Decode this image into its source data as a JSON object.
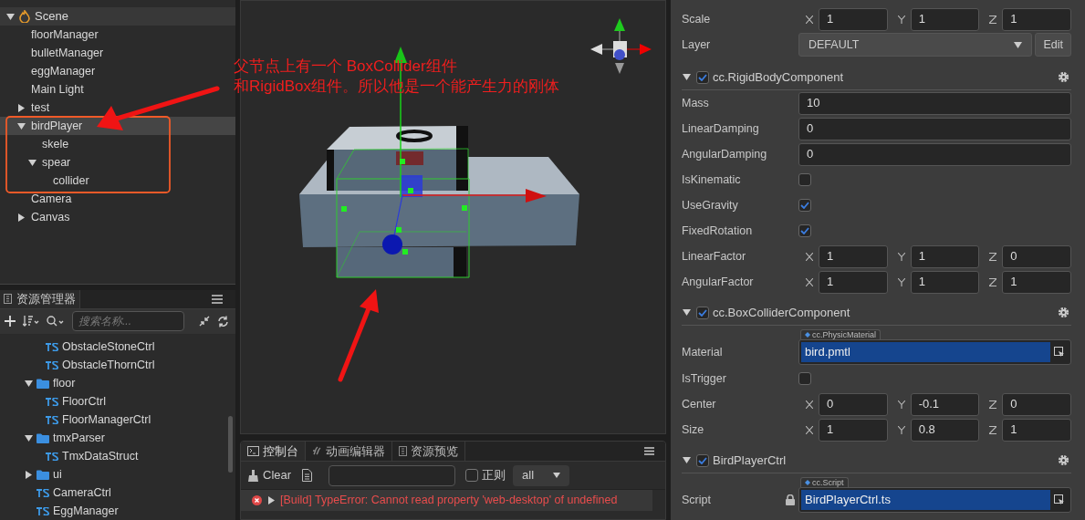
{
  "hierarchy": {
    "root": {
      "label": "Scene",
      "expanded": true,
      "selected": false,
      "children": [
        {
          "label": "floorManager",
          "selected": false
        },
        {
          "label": "bulletManager",
          "selected": false
        },
        {
          "label": "eggManager",
          "selected": false
        },
        {
          "label": "Main Light",
          "selected": false
        },
        {
          "label": "test",
          "expanded": false,
          "selected": false
        },
        {
          "label": "birdPlayer",
          "expanded": true,
          "selected": true,
          "children": [
            {
              "label": "skele",
              "selected": false
            },
            {
              "label": "spear",
              "expanded": true,
              "selected": false,
              "children": [
                {
                  "label": "collider",
                  "selected": false
                }
              ]
            }
          ]
        },
        {
          "label": "Camera",
          "selected": false
        },
        {
          "label": "Canvas",
          "expanded": false,
          "selected": false
        }
      ]
    }
  },
  "assets": {
    "title": "资源管理器",
    "search": {
      "placeholder": "搜索名称..."
    },
    "items": [
      {
        "children": [
          {
            "kind": "script",
            "label": "ObstacleStoneCtrl"
          },
          {
            "kind": "script",
            "label": "ObstacleThornCtrl"
          }
        ]
      },
      {
        "kind": "folder",
        "label": "floor",
        "expanded": true,
        "children": [
          {
            "kind": "script",
            "label": "FloorCtrl"
          },
          {
            "kind": "script",
            "label": "FloorManagerCtrl"
          }
        ]
      },
      {
        "kind": "folder",
        "label": "tmxParser",
        "expanded": true,
        "children": [
          {
            "kind": "script",
            "label": "TmxDataStruct"
          }
        ]
      },
      {
        "kind": "folder",
        "label": "ui",
        "expanded": false
      },
      {
        "kind": "script",
        "label": "CameraCtrl"
      },
      {
        "kind": "script",
        "label": "EggManager"
      }
    ]
  },
  "console": {
    "tabs": [
      {
        "label": "控制台",
        "selected": true
      },
      {
        "label": "动画编辑器",
        "selected": false
      },
      {
        "label": "资源预览",
        "selected": false
      }
    ],
    "clear_label": "Clear",
    "regex": {
      "label": "正则",
      "checked": false
    },
    "level_filter": "all",
    "logs": [
      {
        "text": "[Build] TypeError: Cannot read property 'web-desktop' of undefined",
        "selected": true
      }
    ]
  },
  "inspector": {
    "node_props": [
      {
        "kind": "vec3",
        "label": "Scale",
        "values": [
          "1",
          "1",
          "1"
        ]
      },
      {
        "kind": "dropdown",
        "label": "Layer",
        "value": "DEFAULT",
        "button": "Edit"
      }
    ],
    "components": [
      {
        "title": "cc.RigidBodyComponent",
        "expanded": true,
        "enabled": true,
        "props": [
          {
            "kind": "number",
            "label": "Mass",
            "value": "10"
          },
          {
            "kind": "number",
            "label": "LinearDamping",
            "value": "0"
          },
          {
            "kind": "number",
            "label": "AngularDamping",
            "value": "0"
          },
          {
            "kind": "checkbox",
            "label": "IsKinematic",
            "checked": false
          },
          {
            "kind": "checkbox",
            "label": "UseGravity",
            "checked": true
          },
          {
            "kind": "checkbox",
            "label": "FixedRotation",
            "checked": true
          },
          {
            "kind": "vec3",
            "label": "LinearFactor",
            "values": [
              "1",
              "1",
              "0"
            ]
          },
          {
            "kind": "vec3",
            "label": "AngularFactor",
            "values": [
              "1",
              "1",
              "1"
            ]
          }
        ]
      },
      {
        "title": "cc.BoxColliderComponent",
        "expanded": true,
        "enabled": true,
        "props": [
          {
            "kind": "asset",
            "label": "Material",
            "type": "cc.PhysicMaterial",
            "value": "bird.pmtl",
            "locked": false
          },
          {
            "kind": "checkbox",
            "label": "IsTrigger",
            "checked": false
          },
          {
            "kind": "vec3",
            "label": "Center",
            "values": [
              "0",
              "-0.1",
              "0"
            ]
          },
          {
            "kind": "vec3",
            "label": "Size",
            "values": [
              "1",
              "0.8",
              "1"
            ]
          }
        ]
      },
      {
        "title": "BirdPlayerCtrl",
        "expanded": true,
        "enabled": true,
        "props": [
          {
            "kind": "asset",
            "label": "Script",
            "type": "cc.Script",
            "value": "BirdPlayerCtrl.ts",
            "locked": true
          }
        ]
      }
    ]
  },
  "annotation": {
    "lines": [
      "父节点上有一个 BoxCollider组件",
      "和RigidBox组件。所以他是一个能产生力的刚体"
    ]
  }
}
